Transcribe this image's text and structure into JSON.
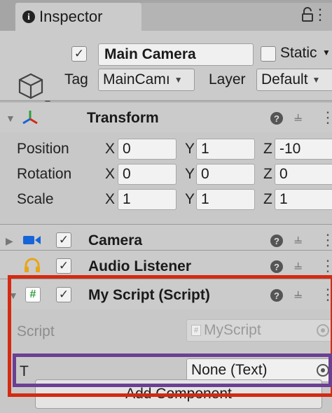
{
  "window": {
    "tab_label": "Inspector",
    "tab_icon": "info-icon"
  },
  "header": {
    "active_checked": true,
    "name": "Main Camera",
    "static_label": "Static",
    "static_checked": false,
    "tag_label": "Tag",
    "tag_value": "MainCamı",
    "layer_label": "Layer",
    "layer_value": "Default"
  },
  "transform": {
    "title": "Transform",
    "rows": [
      {
        "label": "Position",
        "x": "0",
        "y": "1",
        "z": "-10"
      },
      {
        "label": "Rotation",
        "x": "0",
        "y": "0",
        "z": "0"
      },
      {
        "label": "Scale",
        "x": "1",
        "y": "1",
        "z": "1"
      }
    ],
    "axis_x": "X",
    "axis_y": "Y",
    "axis_z": "Z"
  },
  "camera": {
    "title": "Camera",
    "enabled": true
  },
  "audio_listener": {
    "title": "Audio Listener",
    "enabled": true
  },
  "my_script": {
    "title": "My Script (Script)",
    "enabled": true,
    "script_label": "Script",
    "script_value": "MyScript",
    "t_label": "T",
    "t_value": "None (Text)"
  },
  "add_component_label": "Add Component",
  "colors": {
    "highlight_red": "#d42a12",
    "highlight_purple": "#6b3f92",
    "camera_icon": "#1565d8",
    "audio_icon": "#e8a516",
    "script_icon": "#2e9e3a"
  }
}
